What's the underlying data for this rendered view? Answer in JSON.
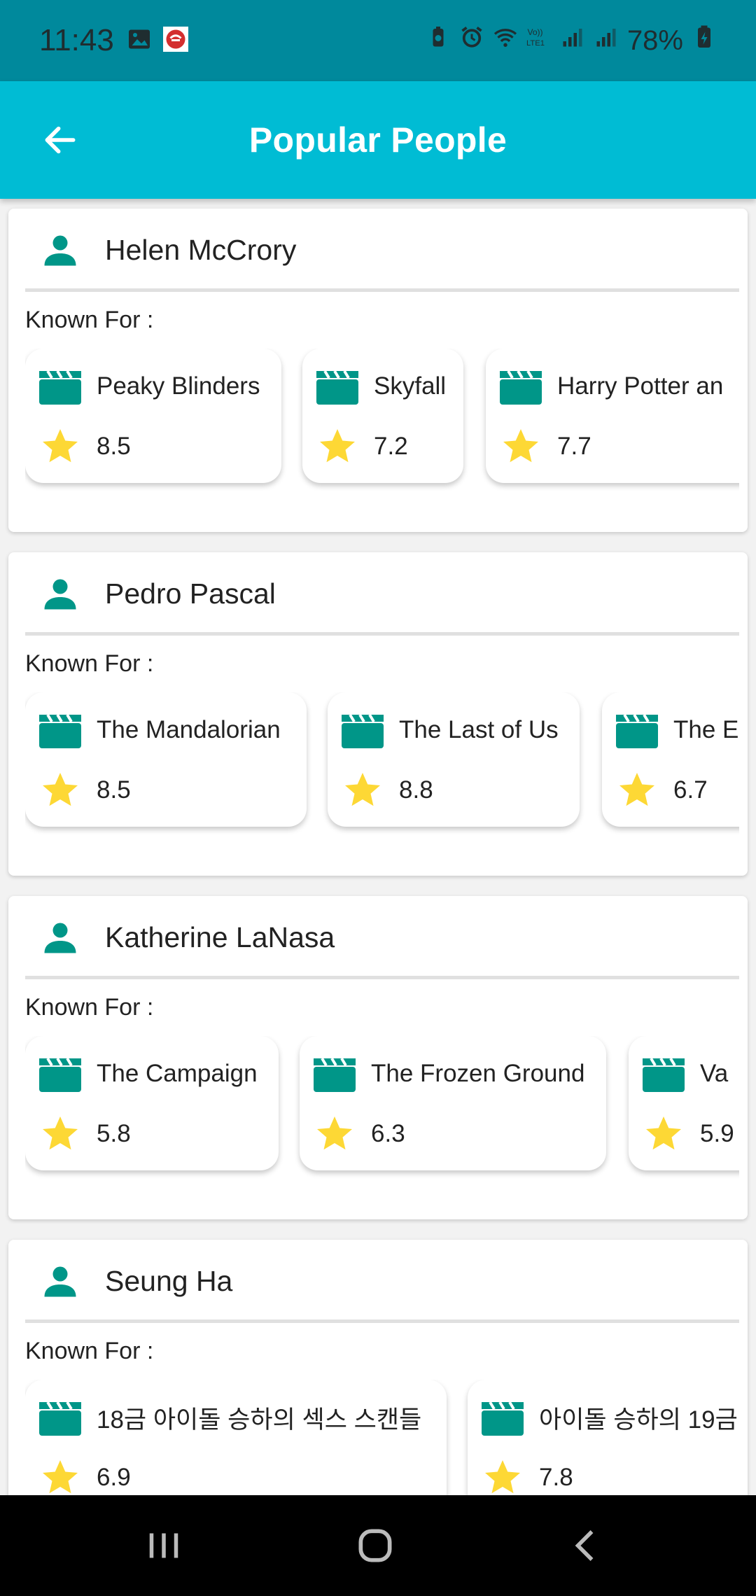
{
  "status_bar": {
    "time": "11:43",
    "battery": "78%",
    "icons": [
      "gallery-icon",
      "pizza-hut-app-icon",
      "battery-saver-icon",
      "alarm-icon",
      "wifi-icon",
      "volte-icon",
      "signal-icon",
      "signal-icon",
      "charging-battery-icon"
    ]
  },
  "app_bar": {
    "title": "Popular People",
    "back_icon": "arrow-back-icon",
    "color": "#00bcd4"
  },
  "colors": {
    "accent": "#009688",
    "star": "#fdd835"
  },
  "people": [
    {
      "name": "Helen McCrory",
      "known_for_label": "Known For :",
      "films": [
        {
          "title": "Peaky Blinders",
          "rating": "8.5"
        },
        {
          "title": "Skyfall",
          "rating": "7.2"
        },
        {
          "title": "Harry Potter an",
          "rating": "7.7"
        }
      ]
    },
    {
      "name": "Pedro Pascal",
      "known_for_label": "Known For :",
      "films": [
        {
          "title": "The Mandalorian",
          "rating": "8.5"
        },
        {
          "title": "The Last of Us",
          "rating": "8.8"
        },
        {
          "title": "The E",
          "rating": "6.7"
        }
      ]
    },
    {
      "name": "Katherine LaNasa",
      "known_for_label": "Known For :",
      "films": [
        {
          "title": "The Campaign",
          "rating": "5.8"
        },
        {
          "title": "The Frozen Ground",
          "rating": "6.3"
        },
        {
          "title": "Va",
          "rating": "5.9"
        }
      ]
    },
    {
      "name": "Seung Ha",
      "known_for_label": "Known For :",
      "films": [
        {
          "title": "18금 아이돌 승하의 섹스 스캔들",
          "rating": "6.9"
        },
        {
          "title": "아이돌 승하의 19금",
          "rating": "7.8"
        }
      ]
    }
  ],
  "nav_bar": {
    "buttons": [
      "recent-apps-icon",
      "home-icon",
      "back-icon"
    ]
  }
}
